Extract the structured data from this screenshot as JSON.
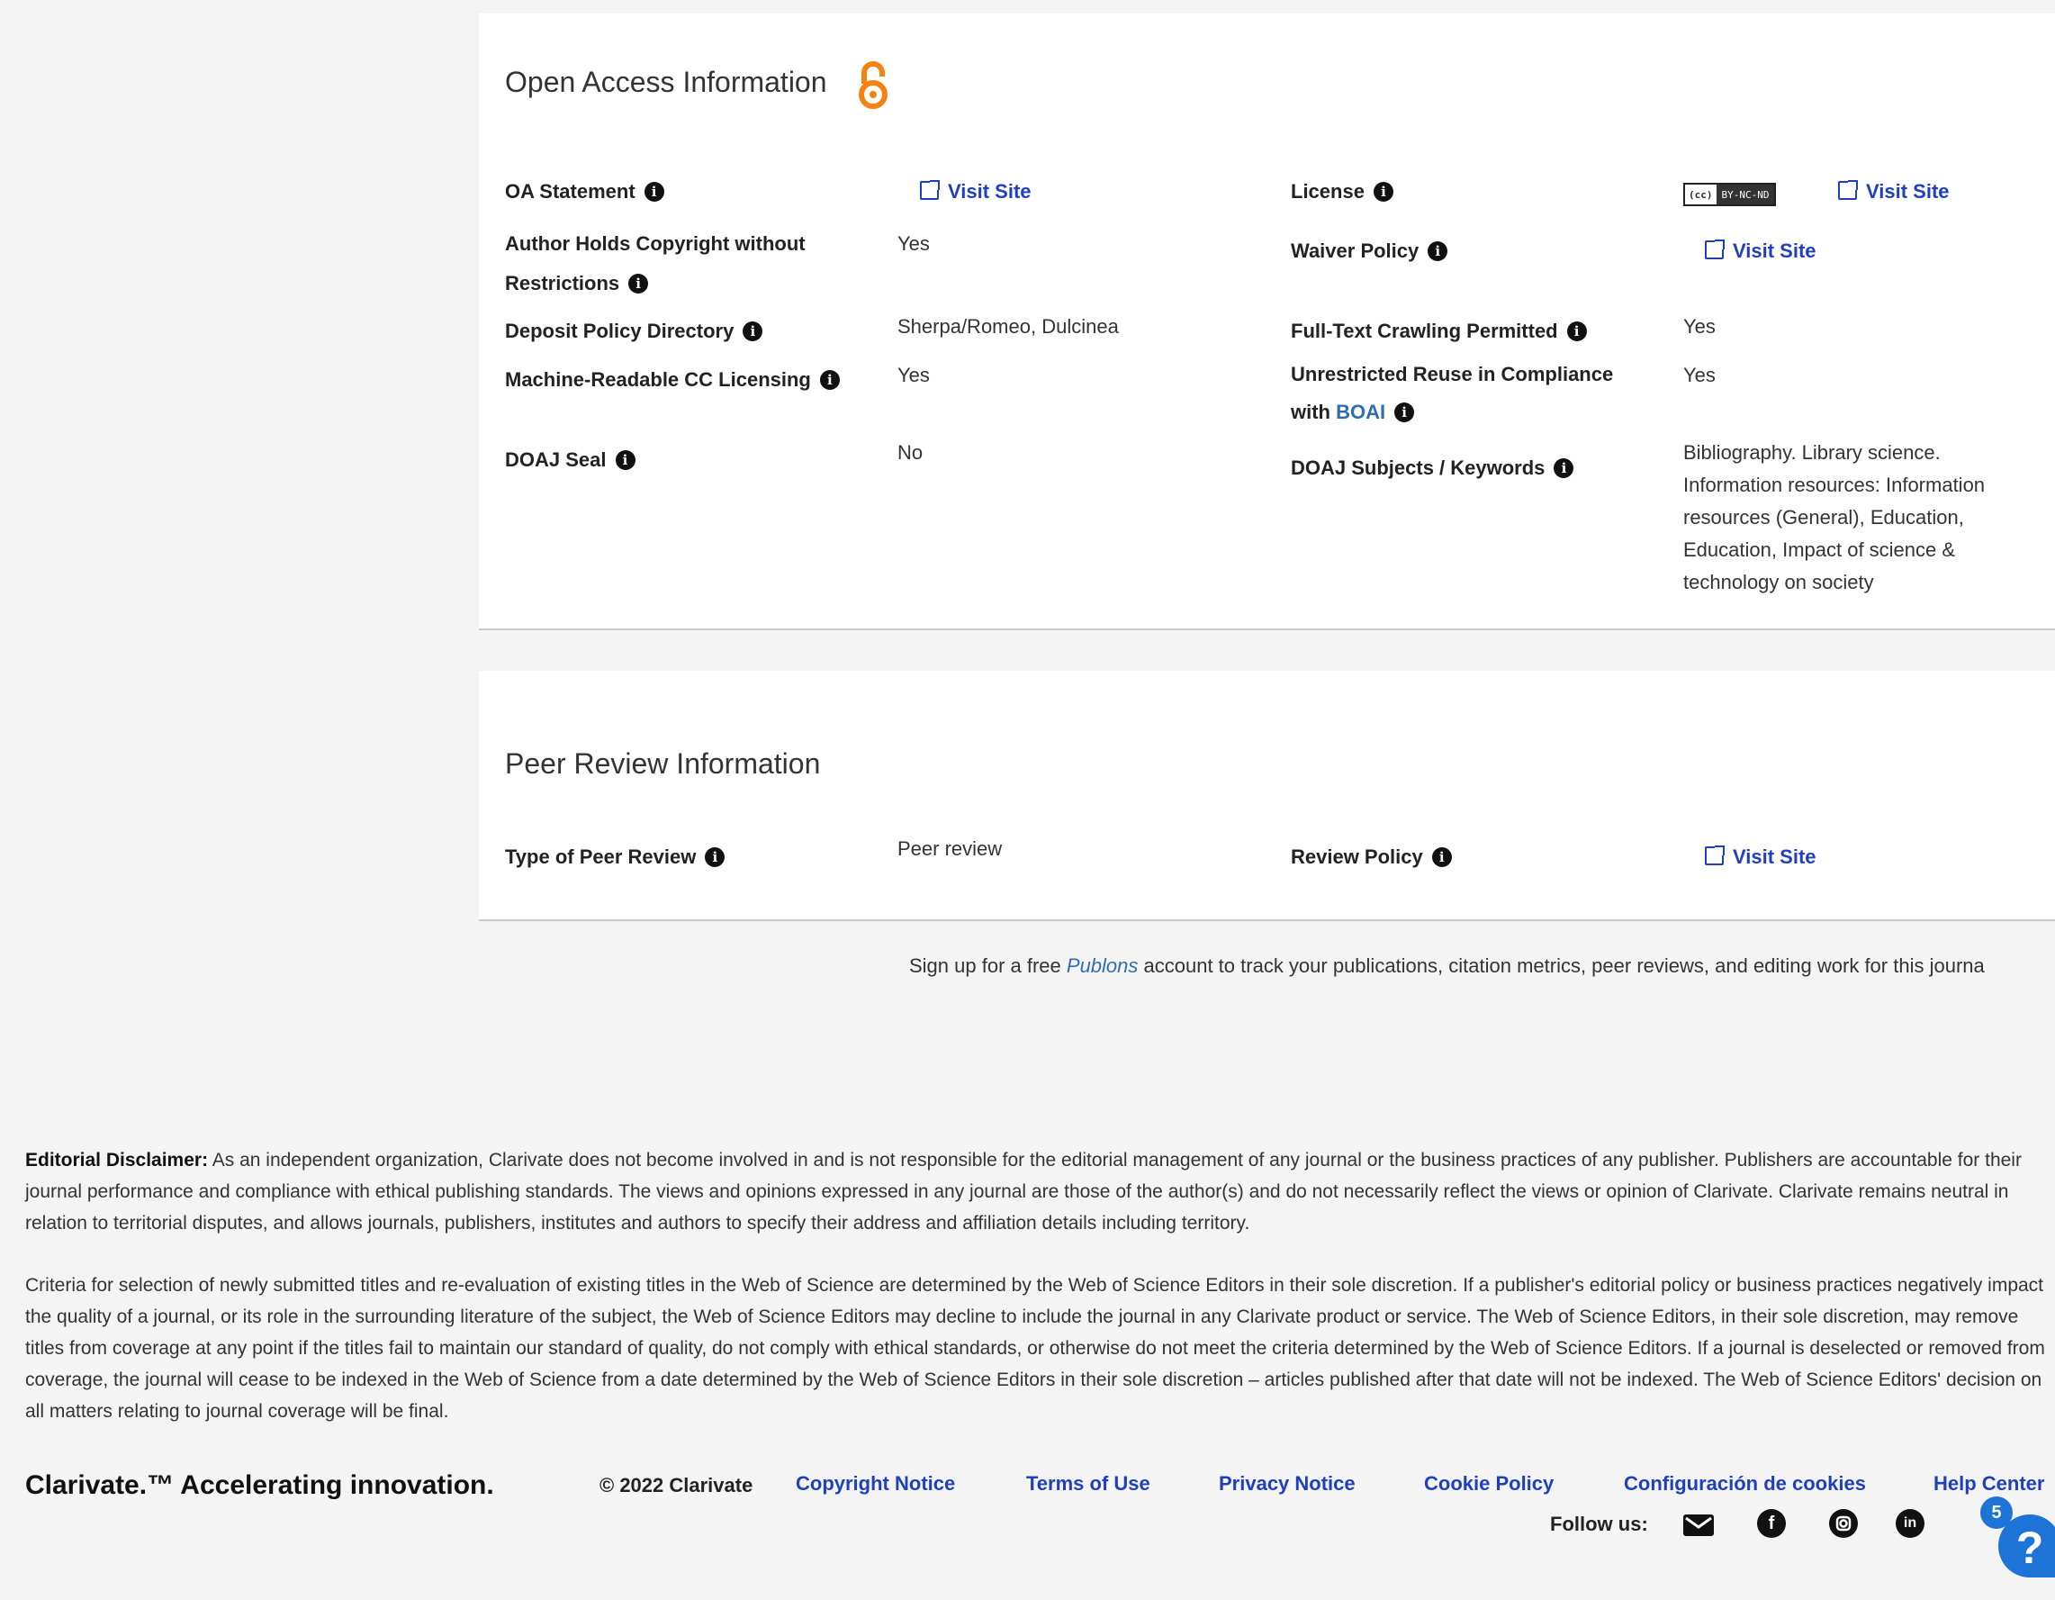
{
  "oa": {
    "title": "Open Access Information",
    "oa_statement_label": "OA Statement",
    "author_copyright_label_1": "Author Holds Copyright without",
    "author_copyright_label_2": "Restrictions",
    "author_copyright_value": "Yes",
    "deposit_label": "Deposit Policy Directory",
    "deposit_value": "Sherpa/Romeo, Dulcinea",
    "machine_label": "Machine-Readable CC Licensing",
    "machine_value": "Yes",
    "doaj_seal_label": "DOAJ Seal",
    "doaj_seal_value": "No",
    "license_label": "License",
    "license_badge_cc": "(cc)",
    "license_badge_terms": "BY-NC-ND",
    "waiver_label": "Waiver Policy",
    "crawling_label": "Full-Text Crawling Permitted",
    "crawling_value": "Yes",
    "reuse_label_1": "Unrestricted Reuse in Compliance",
    "reuse_label_2": "with",
    "reuse_label_boai": "BOAI",
    "reuse_value": "Yes",
    "subjects_label": "DOAJ Subjects / Keywords",
    "subjects_lines": [
      "Bibliography. Library science.",
      "Information resources: Information",
      "resources (General), Education,",
      "Education, Impact of science &",
      "technology on society"
    ],
    "visit_site": "Visit Site"
  },
  "pr": {
    "title": "Peer Review Information",
    "type_label": "Type of Peer Review",
    "type_value": "Peer review",
    "policy_label": "Review Policy",
    "visit_site": "Visit Site"
  },
  "publons": {
    "before": "Sign up for a free ",
    "link": "Publons",
    "after": " account to track your publications, citation metrics, peer reviews, and editing work for this journa"
  },
  "disclaimer": {
    "bold": "Editorial Disclaimer:",
    "text": " As an independent organization, Clarivate does not become involved in and is not responsible for the editorial management of any journal or the business practices of any publisher. Publishers are accountable for their journal performance and compliance with ethical publishing standards. The views and opinions expressed in any journal are those of the author(s) and do not necessarily reflect the views or opinion of Clarivate. Clarivate remains neutral in relation to territorial disputes, and allows journals, publishers, institutes and authors to specify their address and affiliation details including territory.",
    "criteria": "Criteria for selection of newly submitted titles and re-evaluation of existing titles in the Web of Science are determined by the Web of Science Editors in their sole discretion. If a publisher's editorial policy or business practices negatively impact the quality of a journal, or its role in the surrounding literature of the subject, the Web of Science Editors may decline to include the journal in any Clarivate product or service. The Web of Science Editors, in their sole discretion, may remove titles from coverage at any point if the titles fail to maintain our standard of quality, do not comply with ethical standards, or otherwise do not meet the criteria determined by the Web of Science Editors. If a journal is deselected or removed from coverage, the journal will cease to be indexed in the Web of Science from a date determined by the Web of Science Editors in their sole discretion – articles published after that date will not be indexed. The Web of Science Editors' decision on all matters relating to journal coverage will be final."
  },
  "footer": {
    "brand": "Clarivate.™ Accelerating innovation.",
    "copyright": "© 2022 Clarivate",
    "links": [
      "Copyright Notice",
      "Terms of Use",
      "Privacy Notice",
      "Cookie Policy",
      "Configuración de cookies",
      "Help Center"
    ],
    "follow_us": "Follow us:",
    "help_badge": "5",
    "help_glyph": "?"
  },
  "colors": {
    "link": "#1f3fbf",
    "oa_orange": "#f68212",
    "boai": "#2f6db3",
    "help_blue": "#1d73d6"
  },
  "icons": {
    "oa": "open-access-lock-icon",
    "info": "info-icon",
    "external": "external-link-icon",
    "social": [
      "email-icon",
      "facebook-icon",
      "instagram-icon",
      "linkedin-icon"
    ],
    "help": "help-icon"
  }
}
